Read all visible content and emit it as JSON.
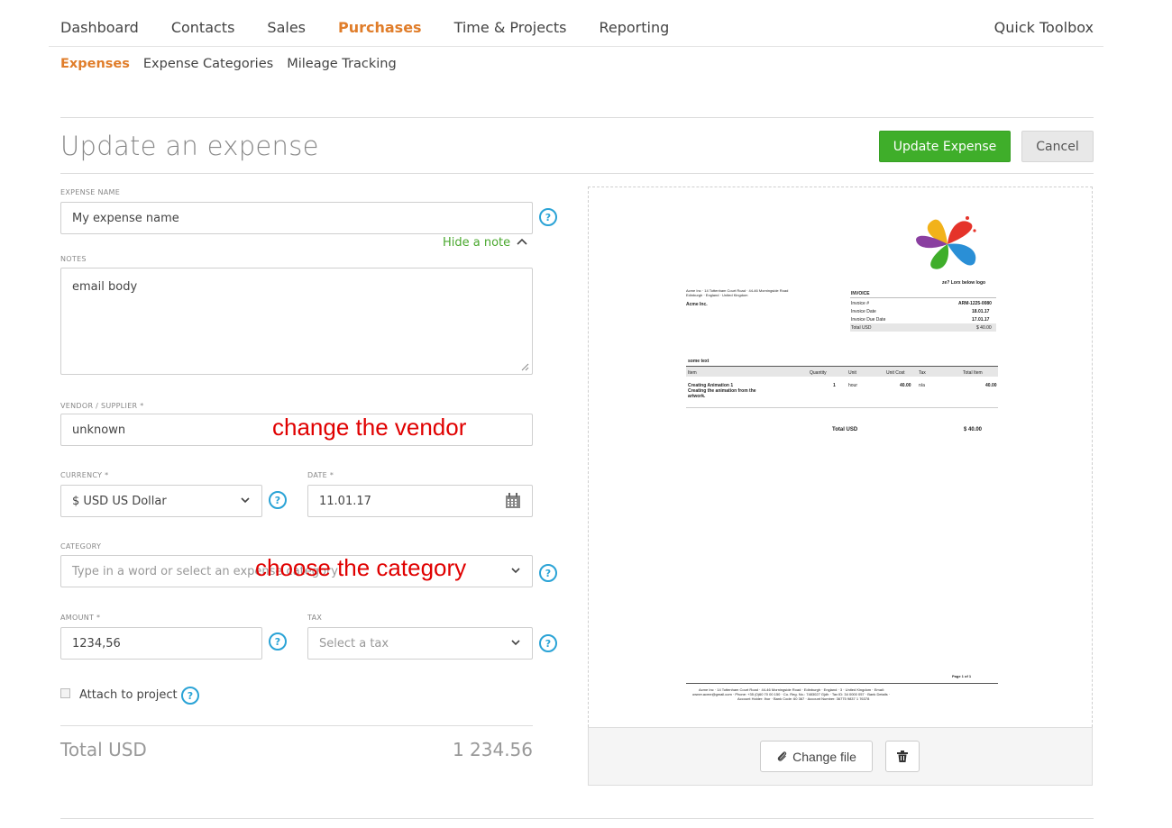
{
  "nav": {
    "items": [
      "Dashboard",
      "Contacts",
      "Sales",
      "Purchases",
      "Time & Projects",
      "Reporting"
    ],
    "active": "Purchases",
    "quick_toolbox": "Quick Toolbox"
  },
  "subnav": {
    "items": [
      "Expenses",
      "Expense Categories",
      "Mileage Tracking"
    ],
    "active": "Expenses"
  },
  "page": {
    "title": "Update an expense",
    "update_button": "Update Expense",
    "cancel_button": "Cancel"
  },
  "form": {
    "expense_name_label": "EXPENSE NAME",
    "expense_name_value": "My expense name",
    "hide_note": "Hide a note",
    "notes_label": "NOTES",
    "notes_value": "email body",
    "vendor_label": "VENDOR / SUPPLIER *",
    "vendor_value": "unknown",
    "currency_label": "CURRENCY *",
    "currency_value": "$ USD US Dollar",
    "date_label": "DATE *",
    "date_value": "11.01.17",
    "category_label": "CATEGORY",
    "category_placeholder": "Type in a word or select an expense category",
    "amount_label": "AMOUNT *",
    "amount_value": "1234,56",
    "tax_label": "TAX",
    "tax_placeholder": "Select a tax",
    "attach_label": "Attach to project",
    "help_glyph": "?"
  },
  "annotations": {
    "vendor": "change the vendor",
    "category": "choose the category"
  },
  "total": {
    "label": "Total USD",
    "value": "1 234.56"
  },
  "preview": {
    "change_file": "Change file",
    "invoice": {
      "logo_caption": "ze? Lorx below logo",
      "from_address": "Acme Inc · 14 Tottenham Court Road · 44-46 Morningside Road",
      "from_address2": "Edinburgh · England · United Kingdom",
      "to_name": "Acme Inc.",
      "invoice_heading": "INVOICE",
      "meta": [
        {
          "k": "Invoice #",
          "v": "ARM-1225-0080"
        },
        {
          "k": "Invoice Date",
          "v": "18.01.17"
        },
        {
          "k": "Invoice Due Date",
          "v": "17.01.17"
        },
        {
          "k": "Total USD",
          "v": "$ 40.00"
        }
      ],
      "some_text": "some text",
      "columns": [
        "Item",
        "Quantity",
        "Unit",
        "Unit Cost",
        "Tax",
        "Total Item"
      ],
      "row": {
        "item": "Creating Animation 1",
        "item_desc1": "Creating the animation from the",
        "item_desc2": "artwork.",
        "quantity": "1",
        "unit": "hour",
        "unit_cost": "40.00",
        "tax": "n/a",
        "total": "40.00"
      },
      "total_label": "Total USD",
      "total_value": "$ 40.00",
      "page": "Page 1 of 1",
      "footer1": "Acme Inc · 14 Tottenham Court Road · 44-46 Morningside Road · Edinburgh · England · 3 · United Kingdom · Email:",
      "footer2": "owner.acme@gmail.com · Phone: +35 (0)60 70 00 150 · Co. Reg. No.: 7483027 Gjdh · Tax ID: 34 0000 057 · Bank Details ·",
      "footer3": "Account Holder: Ihor · Bank Code: 60 367 · Account Number: 36775 9837 1 76378"
    }
  },
  "colors": {
    "accent": "#e07d2a",
    "primary_button": "#3fae2a",
    "help_icon": "#2aa3d6",
    "annotation": "#e00000"
  }
}
